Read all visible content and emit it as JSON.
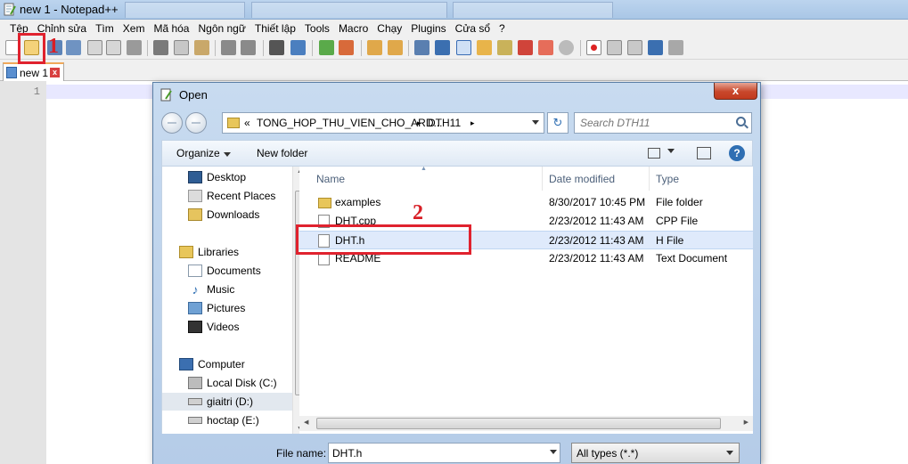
{
  "app": {
    "title": "new 1 - Notepad++"
  },
  "menu": [
    "Tệp",
    "Chỉnh sửa",
    "Tìm",
    "Xem",
    "Mã hóa",
    "Ngôn ngữ",
    "Thiết lập",
    "Tools",
    "Macro",
    "Chạy",
    "Plugins",
    "Cửa sổ",
    "?"
  ],
  "tab": {
    "label": "new 1",
    "close": "x"
  },
  "editor": {
    "line_number": "1"
  },
  "annotations": {
    "step1": "1",
    "step2": "2",
    "color": "#e0222e"
  },
  "dialog": {
    "title": "Open",
    "close": "x",
    "address": {
      "prefix": "«",
      "crumbs": [
        "TONG_HOP_THU_VIEN_CHO_ARD...",
        "DTH11"
      ],
      "separator": "▸"
    },
    "search_placeholder": "Search DTH11",
    "toolbar": {
      "organize": "Organize",
      "new_folder": "New folder"
    },
    "nav": [
      {
        "label": "Desktop",
        "icon": "desktop-icon"
      },
      {
        "label": "Recent Places",
        "icon": "recent-places-icon"
      },
      {
        "label": "Downloads",
        "icon": "downloads-icon"
      },
      {
        "label": "Libraries",
        "icon": "libraries-icon"
      },
      {
        "label": "Documents",
        "icon": "documents-icon"
      },
      {
        "label": "Music",
        "icon": "music-icon"
      },
      {
        "label": "Pictures",
        "icon": "pictures-icon"
      },
      {
        "label": "Videos",
        "icon": "videos-icon"
      },
      {
        "label": "Computer",
        "icon": "computer-icon"
      },
      {
        "label": "Local Disk (C:)",
        "icon": "local-disk-icon"
      },
      {
        "label": "giaitri (D:)",
        "icon": "drive-icon"
      },
      {
        "label": "hoctap (E:)",
        "icon": "drive-icon"
      }
    ],
    "columns": {
      "name": "Name",
      "date": "Date modified",
      "type": "Type"
    },
    "files": [
      {
        "name": "examples",
        "date": "8/30/2017 10:45 PM",
        "type": "File folder",
        "icon": "folder-icon"
      },
      {
        "name": "DHT.cpp",
        "date": "2/23/2012 11:43 AM",
        "type": "CPP File",
        "icon": "file-icon"
      },
      {
        "name": "DHT.h",
        "date": "2/23/2012 11:43 AM",
        "type": "H File",
        "icon": "file-icon"
      },
      {
        "name": "README",
        "date": "2/23/2012 11:43 AM",
        "type": "Text Document",
        "icon": "file-icon"
      }
    ],
    "file_name_label": "File name:",
    "file_name_value": "DHT.h",
    "file_type": "All types (*.*)"
  }
}
